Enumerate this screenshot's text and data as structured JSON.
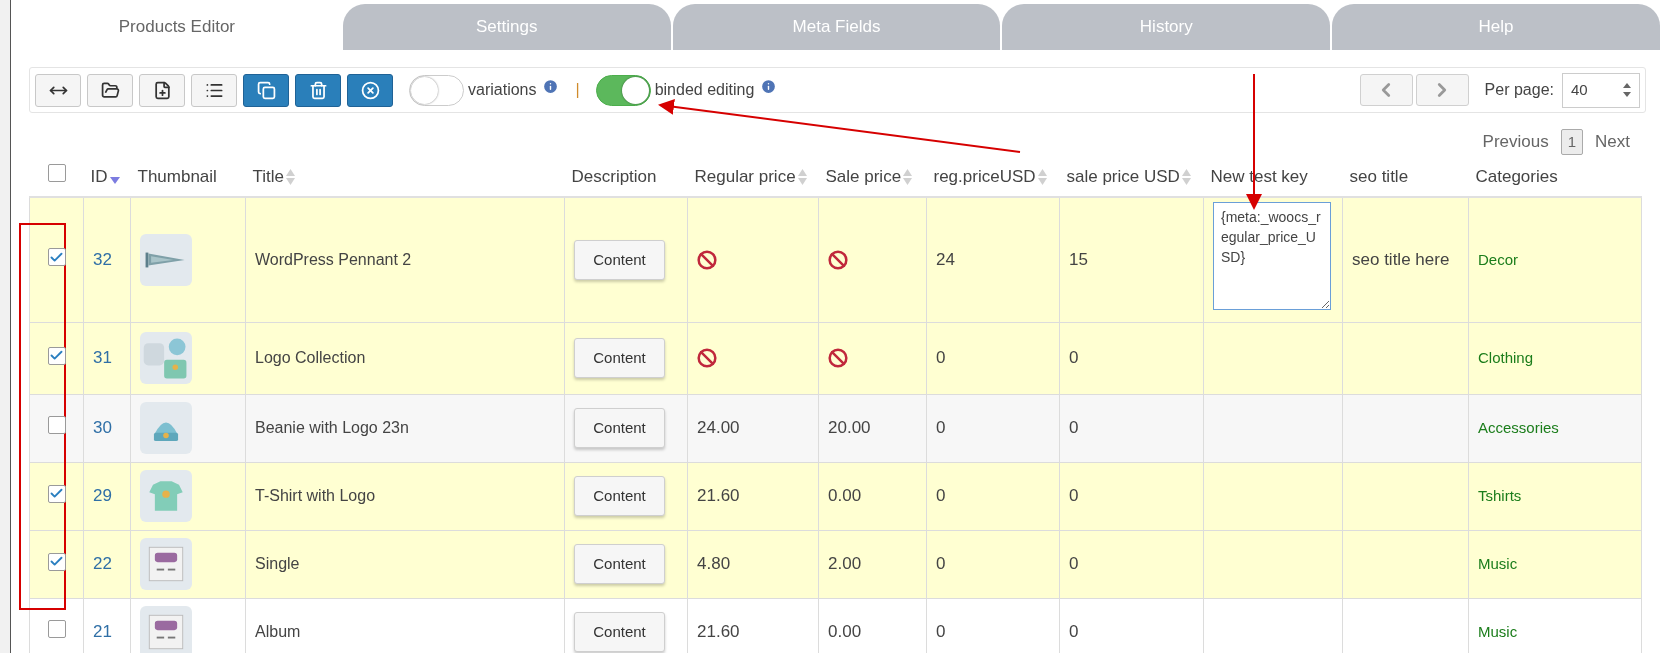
{
  "tabs": [
    {
      "label": "Products Editor",
      "selected": true
    },
    {
      "label": "Settings",
      "selected": false
    },
    {
      "label": "Meta Fields",
      "selected": false
    },
    {
      "label": "History",
      "selected": false
    },
    {
      "label": "Help",
      "selected": false
    }
  ],
  "toolbar": {
    "buttons": [
      {
        "kind": "resize"
      },
      {
        "kind": "folder"
      },
      {
        "kind": "new-file"
      },
      {
        "kind": "list"
      },
      {
        "kind": "copy"
      },
      {
        "kind": "trash"
      },
      {
        "kind": "close"
      }
    ],
    "toggles": [
      {
        "label": "variations",
        "on": false
      },
      {
        "label": "binded editing",
        "on": true
      }
    ],
    "separator": "|",
    "per_page_label": "Per page:",
    "per_page": "40"
  },
  "pagination": {
    "previous": "Previous",
    "pages": [
      {
        "label": "1",
        "selected": true
      }
    ],
    "next": "Next"
  },
  "table": {
    "all_checked": false,
    "columns": [
      {
        "label": "ID",
        "sortable": true,
        "sorted": true
      },
      {
        "label": "Thumbnail",
        "sortable": false,
        "sorted": false
      },
      {
        "label": "Title",
        "sortable": true,
        "sorted": false
      },
      {
        "label": "Description",
        "sortable": false,
        "sorted": false
      },
      {
        "label": "Regular price",
        "sortable": true,
        "sorted": false
      },
      {
        "label": "Sale price",
        "sortable": true,
        "sorted": false
      },
      {
        "label": "reg.priceUSD",
        "sortable": true,
        "sorted": false
      },
      {
        "label": "sale price USD",
        "sortable": true,
        "sorted": false
      },
      {
        "label": "New test key",
        "sortable": false,
        "sorted": false
      },
      {
        "label": "seo title",
        "sortable": false,
        "sorted": false
      },
      {
        "label": "Categories",
        "sortable": false,
        "sorted": false
      }
    ],
    "rows": [
      {
        "checked": true,
        "id": "32",
        "title": "WordPress Pennant 2",
        "description": "Content",
        "regular_price": {
          "kind": "blocked"
        },
        "sale_price": {
          "kind": "blocked"
        },
        "reg_price_usd": "24",
        "sale_price_usd": "15",
        "new_test_key": "{meta:_woocs_regular_price_USD}",
        "seo_title": "seo title here",
        "category": "Decor"
      },
      {
        "checked": true,
        "id": "31",
        "title": "Logo Collection",
        "description": "Content",
        "regular_price": {
          "kind": "blocked"
        },
        "sale_price": {
          "kind": "blocked"
        },
        "reg_price_usd": "0",
        "sale_price_usd": "0",
        "category": "Clothing"
      },
      {
        "checked": false,
        "id": "30",
        "title": "Beanie with Logo 23n",
        "description": "Content",
        "regular_price": {
          "kind": "text",
          "value": "24.00"
        },
        "sale_price": {
          "kind": "text",
          "value": "20.00"
        },
        "reg_price_usd": "0",
        "sale_price_usd": "0",
        "category": "Accessories"
      },
      {
        "checked": true,
        "id": "29",
        "title": "T-Shirt with Logo",
        "description": "Content",
        "regular_price": {
          "kind": "text",
          "value": "21.60"
        },
        "sale_price": {
          "kind": "text",
          "value": "0.00"
        },
        "reg_price_usd": "0",
        "sale_price_usd": "0",
        "category": "Tshirts"
      },
      {
        "checked": true,
        "id": "22",
        "title": "Single",
        "description": "Content",
        "regular_price": {
          "kind": "text",
          "value": "4.80"
        },
        "sale_price": {
          "kind": "text",
          "value": "2.00"
        },
        "reg_price_usd": "0",
        "sale_price_usd": "0",
        "category": "Music"
      },
      {
        "checked": false,
        "id": "21",
        "title": "Album",
        "description": "Content",
        "regular_price": {
          "kind": "text",
          "value": "21.60"
        },
        "sale_price": {
          "kind": "text",
          "value": "0.00"
        },
        "reg_price_usd": "0",
        "sale_price_usd": "0",
        "category": "Music"
      }
    ]
  }
}
